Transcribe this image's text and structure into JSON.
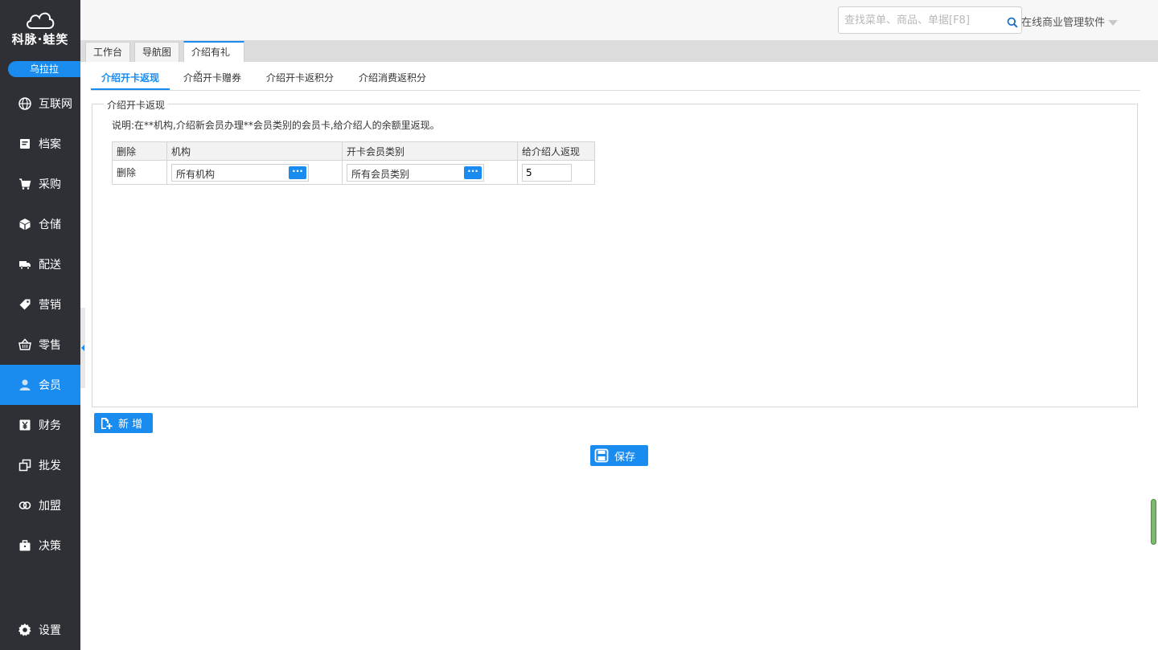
{
  "brand": {
    "name": "科脉·蛙笑",
    "user": "乌拉拉"
  },
  "sidebar": {
    "items": [
      {
        "label": "互联网",
        "icon": "globe-icon"
      },
      {
        "label": "档案",
        "icon": "file-icon"
      },
      {
        "label": "采购",
        "icon": "cart-icon"
      },
      {
        "label": "仓储",
        "icon": "box-icon"
      },
      {
        "label": "配送",
        "icon": "truck-icon"
      },
      {
        "label": "营销",
        "icon": "tag-icon"
      },
      {
        "label": "零售",
        "icon": "basket-icon"
      },
      {
        "label": "会员",
        "icon": "user-icon"
      },
      {
        "label": "财务",
        "icon": "yen-icon"
      },
      {
        "label": "批发",
        "icon": "copy-icon"
      },
      {
        "label": "加盟",
        "icon": "rings-icon"
      },
      {
        "label": "决策",
        "icon": "briefcase-icon"
      }
    ],
    "active_label": "会员",
    "settings_label": "设置"
  },
  "header": {
    "search_placeholder": "查找菜单、商品、单据[F8]",
    "company": "在线商业管理软件"
  },
  "tabs": [
    {
      "label": "工作台"
    },
    {
      "label": "导航图"
    },
    {
      "label": "介绍有礼",
      "close": "×"
    }
  ],
  "subtabs": [
    {
      "label": "介绍开卡返现"
    },
    {
      "label": "介绍开卡赠券"
    },
    {
      "label": "介绍开卡返积分"
    },
    {
      "label": "介绍消费返积分"
    }
  ],
  "section": {
    "legend": "介绍开卡返现",
    "description": "说明:在**机构,介绍新会员办理**会员类别的会员卡,给介绍人的余额里返现。"
  },
  "table": {
    "headers": [
      "删除",
      "机构",
      "开卡会员类别",
      "给介绍人返现"
    ],
    "rows": [
      {
        "delete": "删除",
        "org": "所有机构",
        "member_type": "所有会员类别",
        "cashback": "5"
      }
    ],
    "picker_dots": "···"
  },
  "buttons": {
    "add": "新 增",
    "save": "保存"
  },
  "colors": {
    "accent": "#1a8cf0",
    "sidebar_bg": "#2f3036"
  }
}
